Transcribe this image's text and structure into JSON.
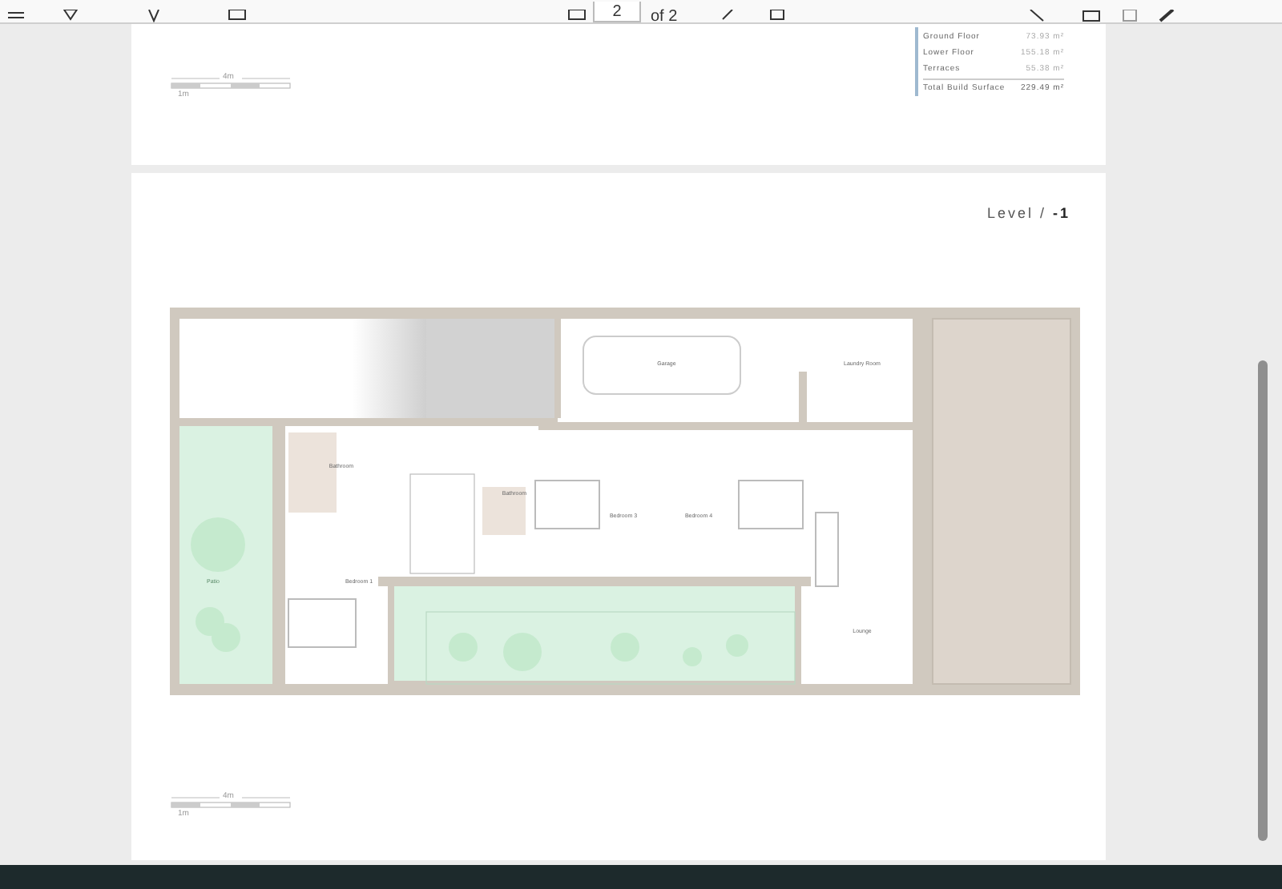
{
  "toolbar": {
    "page_number": "2",
    "page_count": "of 2"
  },
  "page_1": {
    "scale_bar": {
      "distance": "4m",
      "origin": "1m"
    },
    "areas": [
      {
        "label": "Ground Floor",
        "value": "73.93 m²"
      },
      {
        "label": "Lower Floor",
        "value": "155.18 m²"
      },
      {
        "label": "Terraces",
        "value": "55.38 m²"
      }
    ],
    "total": {
      "label": "Total Build Surface",
      "value": "229.49 m²"
    }
  },
  "page_2": {
    "level": {
      "label": "Level /",
      "value": "-1"
    },
    "rooms": [
      {
        "name": "Garage",
        "kind": "room"
      },
      {
        "name": "Laundry Room",
        "kind": "room"
      },
      {
        "name": "Bathroom",
        "kind": "room"
      },
      {
        "name": "Bathroom",
        "kind": "room"
      },
      {
        "name": "Bedroom 3",
        "kind": "room"
      },
      {
        "name": "Bedroom 4",
        "kind": "room"
      },
      {
        "name": "Patio",
        "kind": "garden"
      },
      {
        "name": "Bedroom 1",
        "kind": "room"
      },
      {
        "name": "Lounge",
        "kind": "room"
      }
    ],
    "scale_bar": {
      "distance": "4m",
      "origin": "1m"
    }
  }
}
